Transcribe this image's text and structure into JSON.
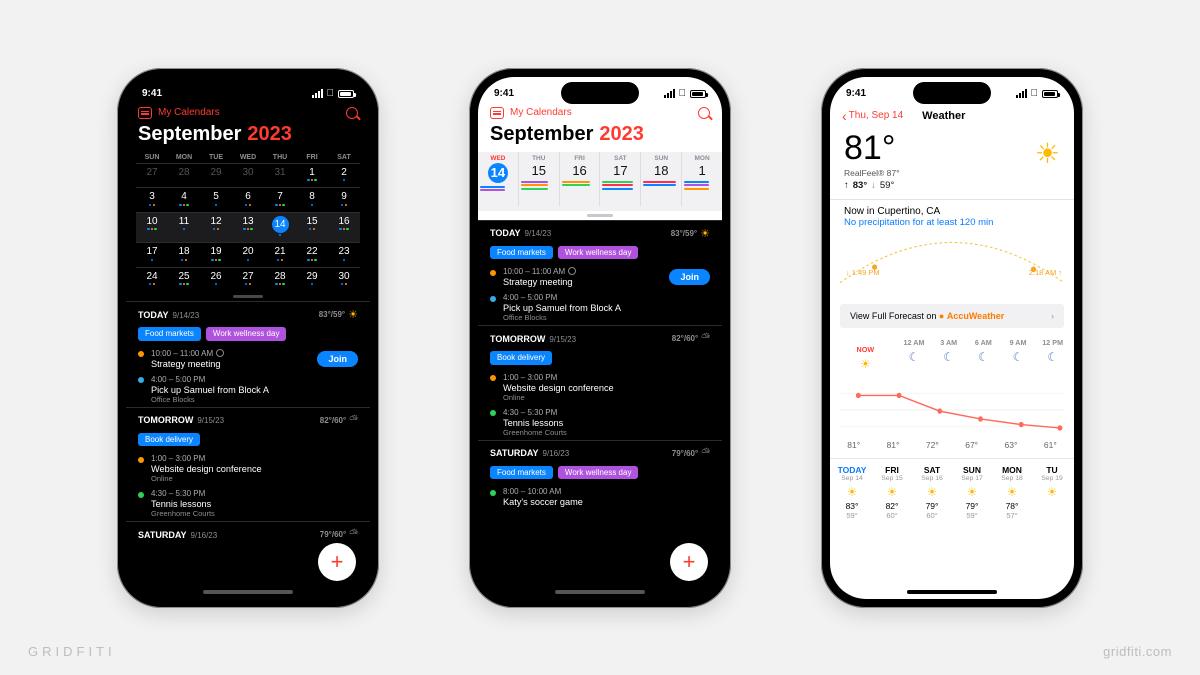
{
  "watermark": {
    "left": "GRIDFITI",
    "right": "gridfiti.com"
  },
  "status": {
    "time": "9:41"
  },
  "app": {
    "back_label": "My Calendars",
    "month": "September",
    "year": "2023"
  },
  "month_grid": {
    "dow": [
      "SUN",
      "MON",
      "TUE",
      "WED",
      "THU",
      "FRI",
      "SAT"
    ],
    "rows": [
      [
        "27",
        "28",
        "29",
        "30",
        "31",
        "1",
        "2"
      ],
      [
        "3",
        "4",
        "5",
        "6",
        "7",
        "8",
        "9"
      ],
      [
        "10",
        "11",
        "12",
        "13",
        "14",
        "15",
        "16"
      ],
      [
        "17",
        "18",
        "19",
        "20",
        "21",
        "22",
        "23"
      ],
      [
        "24",
        "25",
        "26",
        "27",
        "28",
        "29",
        "30"
      ]
    ]
  },
  "week_strip": [
    {
      "dow": "WED",
      "num": "14",
      "today": true
    },
    {
      "dow": "THU",
      "num": "15"
    },
    {
      "dow": "FRI",
      "num": "16"
    },
    {
      "dow": "SAT",
      "num": "17"
    },
    {
      "dow": "SUN",
      "num": "18"
    },
    {
      "dow": "MON",
      "num": "1"
    }
  ],
  "days": {
    "today": {
      "label": "TODAY",
      "date": "9/14/23",
      "hi_lo": "83°/59°",
      "tags": [
        {
          "t": "Food markets",
          "c": "c-blue"
        },
        {
          "t": "Work wellness day",
          "c": "c-violet"
        }
      ],
      "events": [
        {
          "dot": "c-orange",
          "time": "10:00 – 11:00 AM",
          "ring": true,
          "name": "Strategy meeting",
          "join": true
        },
        {
          "dot": "c-teal",
          "time": "4:00 – 5:00 PM",
          "name": "Pick up Samuel from Block A",
          "loc": "Office Blocks"
        }
      ]
    },
    "tomorrow": {
      "label": "TOMORROW",
      "date": "9/15/23",
      "hi_lo": "82°/60°",
      "tags": [
        {
          "t": "Book delivery",
          "c": "c-blue"
        }
      ],
      "events": [
        {
          "dot": "c-orange",
          "time": "1:00 – 3:00 PM",
          "name": "Website design conference",
          "loc": "Online"
        },
        {
          "dot": "c-green",
          "time": "4:30 – 5:30 PM",
          "name": "Tennis lessons",
          "loc": "Greenhome Courts"
        }
      ]
    },
    "saturday": {
      "label": "SATURDAY",
      "date": "9/16/23",
      "hi_lo": "79°/60°",
      "tags": [
        {
          "t": "Food markets",
          "c": "c-blue"
        },
        {
          "t": "Work wellness day",
          "c": "c-violet"
        }
      ],
      "events": [
        {
          "dot": "c-green",
          "time": "8:00 – 10:00 AM",
          "name": "Katy's soccer game"
        }
      ]
    }
  },
  "join_label": "Join",
  "weather": {
    "back": "Thu, Sep 14",
    "title": "Weather",
    "temp": "81°",
    "realfeel_label": "RealFeel®",
    "realfeel": "87°",
    "hi": "83°",
    "lo": "59°",
    "now_loc": "Now in Cupertino, CA",
    "precip": "No precipitation for at least 120 min",
    "sunset": "1:49 PM",
    "sunrise": "2:18 AM",
    "vff_pre": "View Full Forecast on",
    "aw": "AccuWeather",
    "hourly": [
      {
        "t": "NOW",
        "temp": "81°",
        "now": true,
        "sun": true
      },
      {
        "t": "12 AM",
        "temp": "81°"
      },
      {
        "t": "3 AM",
        "temp": "72°"
      },
      {
        "t": "6 AM",
        "temp": "67°"
      },
      {
        "t": "9 AM",
        "temp": "63°"
      },
      {
        "t": "12 PM",
        "temp": "61°"
      }
    ],
    "daily": [
      {
        "d": "TODAY",
        "s": "Sep 14",
        "hi": "83°",
        "lo": "59°",
        "today": true
      },
      {
        "d": "FRI",
        "s": "Sep 15",
        "hi": "82°",
        "lo": "60°"
      },
      {
        "d": "SAT",
        "s": "Sep 16",
        "hi": "79°",
        "lo": "60°"
      },
      {
        "d": "SUN",
        "s": "Sep 17",
        "hi": "79°",
        "lo": "59°"
      },
      {
        "d": "MON",
        "s": "Sep 18",
        "hi": "78°",
        "lo": "57°"
      },
      {
        "d": "TU",
        "s": "Sep 19",
        "hi": "",
        "lo": ""
      }
    ]
  },
  "chart_data": {
    "type": "line",
    "title": "Hourly temperature",
    "x": [
      "NOW",
      "12 AM",
      "3 AM",
      "6 AM",
      "9 AM",
      "12 PM"
    ],
    "values": [
      81,
      81,
      72,
      67,
      63,
      61
    ],
    "ylim": [
      55,
      85
    ],
    "ylabel": "°F"
  }
}
